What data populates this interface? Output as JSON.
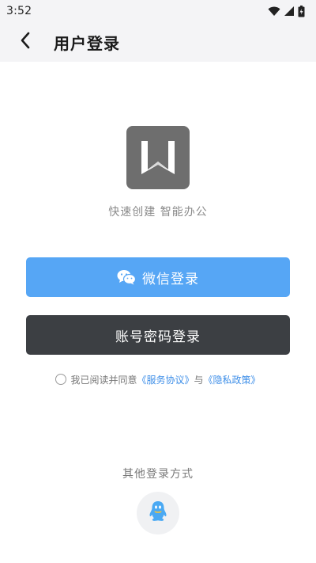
{
  "status_bar": {
    "time": "3:52"
  },
  "header": {
    "title": "用户登录"
  },
  "brand": {
    "slogan": "快速创建 智能办公"
  },
  "buttons": {
    "wechat_label": "微信登录",
    "account_label": "账号密码登录"
  },
  "agreement": {
    "prefix": "我已阅读并同意",
    "service_link": "《服务协议》",
    "connector": "与",
    "privacy_link": "《隐私政策》",
    "checked": false
  },
  "other_login": {
    "title": "其他登录方式",
    "options": [
      "qq-icon"
    ]
  },
  "colors": {
    "wechat_button": "#56a6f5",
    "account_button": "#3c3f43",
    "link": "#3d8ee8",
    "logo_bg": "#6e6e6e"
  }
}
